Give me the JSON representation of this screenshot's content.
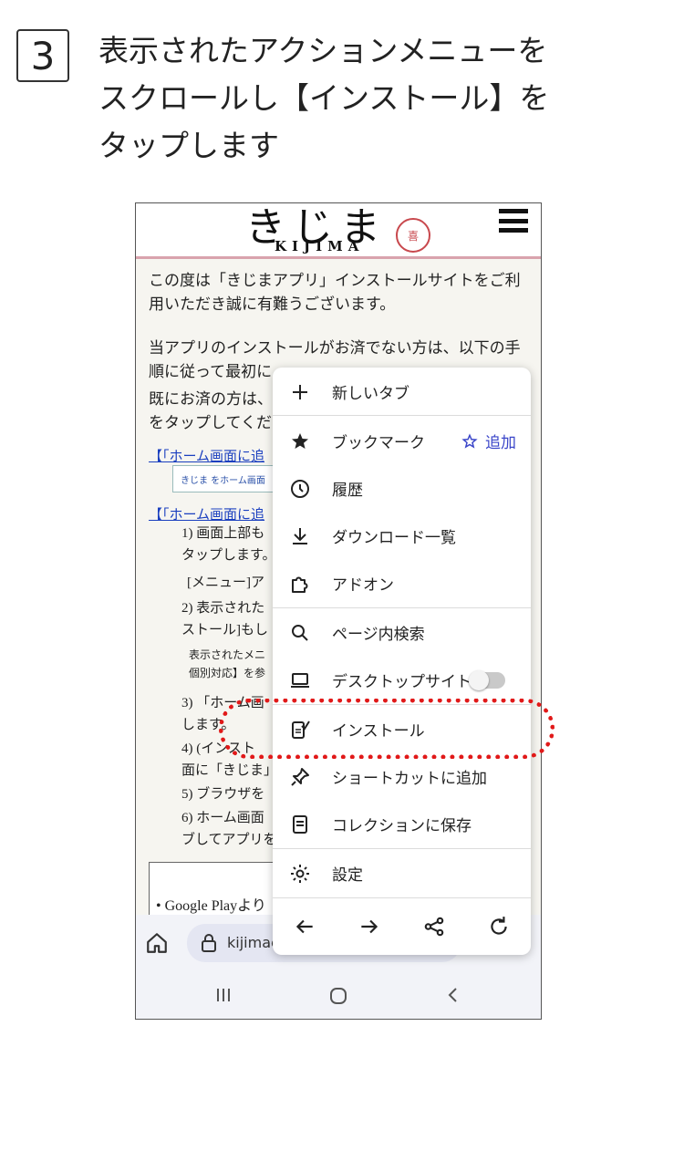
{
  "step": {
    "number": "3"
  },
  "instruction": {
    "lines": [
      "表示されたアクションメニューを",
      "スクロールし【インストール】を",
      "タップします"
    ]
  },
  "site": {
    "logo_script": "きじま",
    "logo_text": "KIJIMA",
    "seal": "喜",
    "para1": "この度は「きじまアプリ」インストールサイトをご利用いただき誠に有難うございます。",
    "para2": "当アプリのインストールがお済でない方は、以下の手順に従って最初に",
    "para3": "既にお済の方は、",
    "para3b": "をタップしてくだ",
    "link1": "【「ホーム画面に追",
    "button_preview": "きじま をホーム画面",
    "link2": "【「ホーム画面に追",
    "steps": [
      "1) 画面上部も",
      "タップします。",
      "[メニュー]ア",
      "2) 表示された",
      "ストール]もし",
      "表示されたメニ",
      "個別対応】を参",
      "3) 「ホーム画",
      "します。",
      "4) (インスト",
      "面に「きじま」",
      "5) ブラウザを",
      "6) ホーム画面",
      "ブしてアプリを"
    ],
    "google_play": "• Google Playより"
  },
  "browser": {
    "url": "kijimac"
  },
  "menu": {
    "items": [
      {
        "label": "新しいタブ",
        "icon": "plus-icon"
      },
      {
        "label": "ブックマーク",
        "icon": "star-filled-icon",
        "extra": "追加"
      },
      {
        "label": "履歴",
        "icon": "clock-icon"
      },
      {
        "label": "ダウンロード一覧",
        "icon": "download-icon"
      },
      {
        "label": "アドオン",
        "icon": "puzzle-icon"
      },
      {
        "label": "ページ内検索",
        "icon": "search-icon"
      },
      {
        "label": "デスクトップサイト",
        "icon": "laptop-icon"
      },
      {
        "label": "インストール",
        "icon": "install-app-icon"
      },
      {
        "label": "ショートカットに追加",
        "icon": "pin-icon"
      },
      {
        "label": "コレクションに保存",
        "icon": "collection-icon"
      },
      {
        "label": "設定",
        "icon": "gear-icon"
      }
    ],
    "desktop_site_enabled": false
  },
  "colors": {
    "highlight": "#e11919",
    "accent": "#3b46c9",
    "header_border": "#d9a3ad"
  }
}
